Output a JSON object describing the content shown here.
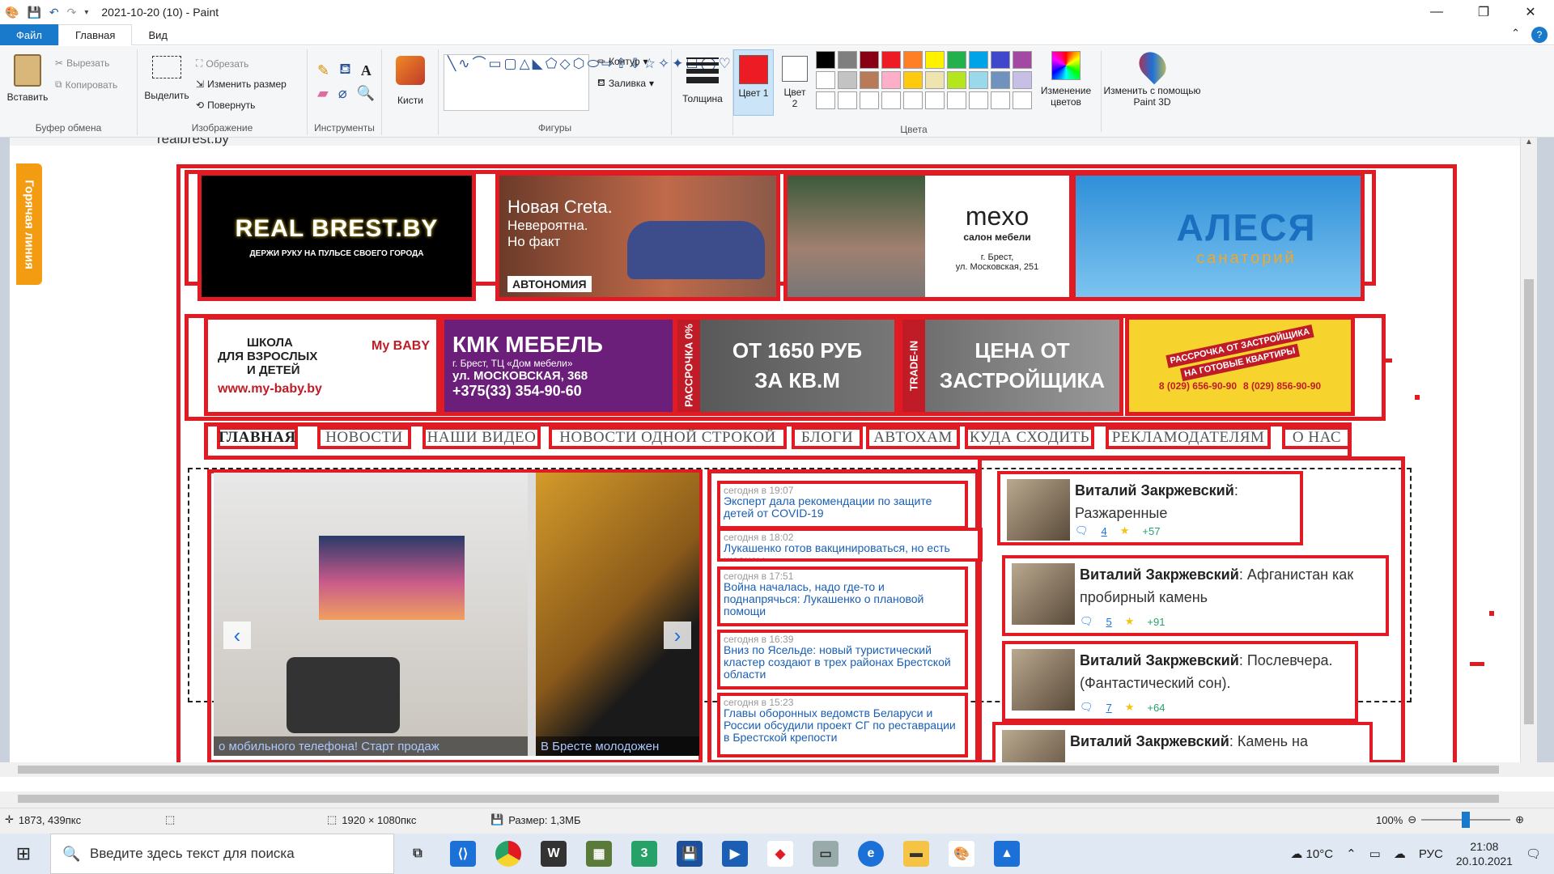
{
  "titlebar": {
    "title": "2021-10-20 (10) - Paint",
    "min": "—",
    "max": "❐",
    "close": "✕"
  },
  "tabs": {
    "file": "Файл",
    "home": "Главная",
    "view": "Вид"
  },
  "ribbon": {
    "clipboard": {
      "paste": "Вставить",
      "cut": "Вырезать",
      "copy": "Копировать",
      "group": "Буфер обмена"
    },
    "image": {
      "select": "Выделить",
      "crop": "Обрезать",
      "resize": "Изменить размер",
      "rotate": "Повернуть",
      "group": "Изображение"
    },
    "tools": {
      "group": "Инструменты"
    },
    "brushes": {
      "label": "Кисти"
    },
    "shapes": {
      "outline": "Контур",
      "fill": "Заливка",
      "group": "Фигуры"
    },
    "thickness": {
      "label": "Толщина"
    },
    "color1": {
      "label": "Цвет 1",
      "value": "#ed1c24"
    },
    "color2": {
      "label": "Цвет 2",
      "value": "#ffffff"
    },
    "colors_group": "Цвета",
    "edit_colors": "Изменение цветов",
    "paint3d": "Изменить с помощью Paint 3D",
    "palette": [
      "#000000",
      "#7f7f7f",
      "#880015",
      "#ed1c24",
      "#ff7f27",
      "#fff200",
      "#22b14c",
      "#00a2e8",
      "#3f48cc",
      "#a349a4",
      "#ffffff",
      "#c3c3c3",
      "#b97a57",
      "#ffaec9",
      "#ffc90e",
      "#efe4b0",
      "#b5e61d",
      "#99d9ea",
      "#7092be",
      "#c8bfe7",
      "#ffffff",
      "#ffffff",
      "#ffffff",
      "#ffffff",
      "#ffffff",
      "#ffffff",
      "#ffffff",
      "#ffffff",
      "#ffffff",
      "#ffffff"
    ]
  },
  "page": {
    "url": "realbrest.by",
    "side_tab": "Горячая линия",
    "banners_top": [
      {
        "line1": "REAL BREST.BY",
        "line2": "ДЕРЖИ РУКУ НА ПУЛЬСЕ СВОЕГО ГОРОДА"
      },
      {
        "line1": "Новая Creta.",
        "line2": "Невероятна.",
        "line3": "Но факт",
        "brand": "АВТОНОМИЯ"
      },
      {
        "line1": "mexo",
        "line2": "салон мебели",
        "line3": "г. Брест,",
        "line4": "ул. Московская, 251"
      },
      {
        "line1": "АЛЕСЯ",
        "line2": "санаторий"
      }
    ],
    "banners_mid": [
      {
        "line1": "ШКОЛА",
        "line2": "ДЛЯ ВЗРОСЛЫХ",
        "line3": "И ДЕТЕЙ",
        "line4": "www.my-baby.by",
        "brand": "My BABY"
      },
      {
        "line1": "КМК МЕБЕЛЬ",
        "line2": "г. Брест, ТЦ «Дом мебели»",
        "line3": "ул. МОСКОВСКАЯ, 368",
        "line4": "+375(33) 354-90-60"
      },
      {
        "side": "РАССРОЧКА 0%",
        "line1": "ОТ 1650 РУБ",
        "line2": "ЗА КВ.М"
      },
      {
        "side": "TRADE-IN",
        "line1": "ЦЕНА ОТ",
        "line2": "ЗАСТРОЙЩИКА"
      },
      {
        "line1": "РАССРОЧКА ОТ ЗАСТРОЙЩИКА",
        "line2": "НА ГОТОВЫЕ КВАРТИРЫ",
        "line3": "8 (029) 656-90-90",
        "line4": "8 (029) 856-90-90"
      }
    ],
    "nav": [
      "ГЛАВНАЯ",
      "НОВОСТИ",
      "НАШИ ВИДЕО",
      "НОВОСТИ ОДНОЙ СТРОКОЙ",
      "БЛОГИ",
      "АВТОХАМ",
      "КУДА СХОДИТЬ",
      "РЕКЛАМОДАТЕЛЯМ",
      "О НАС"
    ],
    "slider": {
      "caption1": "о мобильного телефона! Старт продаж",
      "caption2": "В Бресте молодожен",
      "prev": "‹",
      "next": "›"
    },
    "news": [
      {
        "time": "сегодня в 19:07",
        "headline": "Эксперт дала рекомендации по защите детей от COVID-19"
      },
      {
        "time": "сегодня в 18:02",
        "headline": "Лукашенко готов вакцинироваться, но есть нюансы"
      },
      {
        "time": "сегодня в 17:51",
        "headline": "Война началась, надо где-то и поднапрячься: Лукашенко о плановой помощи"
      },
      {
        "time": "сегодня в 16:39",
        "headline": "Вниз по Ясельде: новый туристический кластер создают в трех районах Брестской области"
      },
      {
        "time": "сегодня в 15:23",
        "headline": "Главы оборонных ведомств Беларуси и России обсудили проект СГ по реставрации в Брестской крепости"
      }
    ],
    "blogs": [
      {
        "author": "Виталий Закржевский",
        "title": "Разжаренные",
        "comments": "4",
        "rating": "+57"
      },
      {
        "author": "Виталий Закржевский",
        "title": "Афганистан как пробирный камень",
        "comments": "5",
        "rating": "+91"
      },
      {
        "author": "Виталий Закржевский",
        "title": "Послевчера. (Фантастический сон).",
        "comments": "7",
        "rating": "+64"
      },
      {
        "author": "Виталий Закржевский",
        "title": "Камень на",
        "comments": "",
        "rating": ""
      }
    ]
  },
  "status": {
    "cursor": "1873, 439пкс",
    "dimensions": "1920 × 1080пкс",
    "size": "Размер: 1,3МБ",
    "zoom": "100%"
  },
  "taskbar": {
    "search_placeholder": "Введите здесь текст для поиска",
    "weather": "10°C",
    "lang": "РУС",
    "time": "21:08",
    "date": "20.10.2021"
  }
}
